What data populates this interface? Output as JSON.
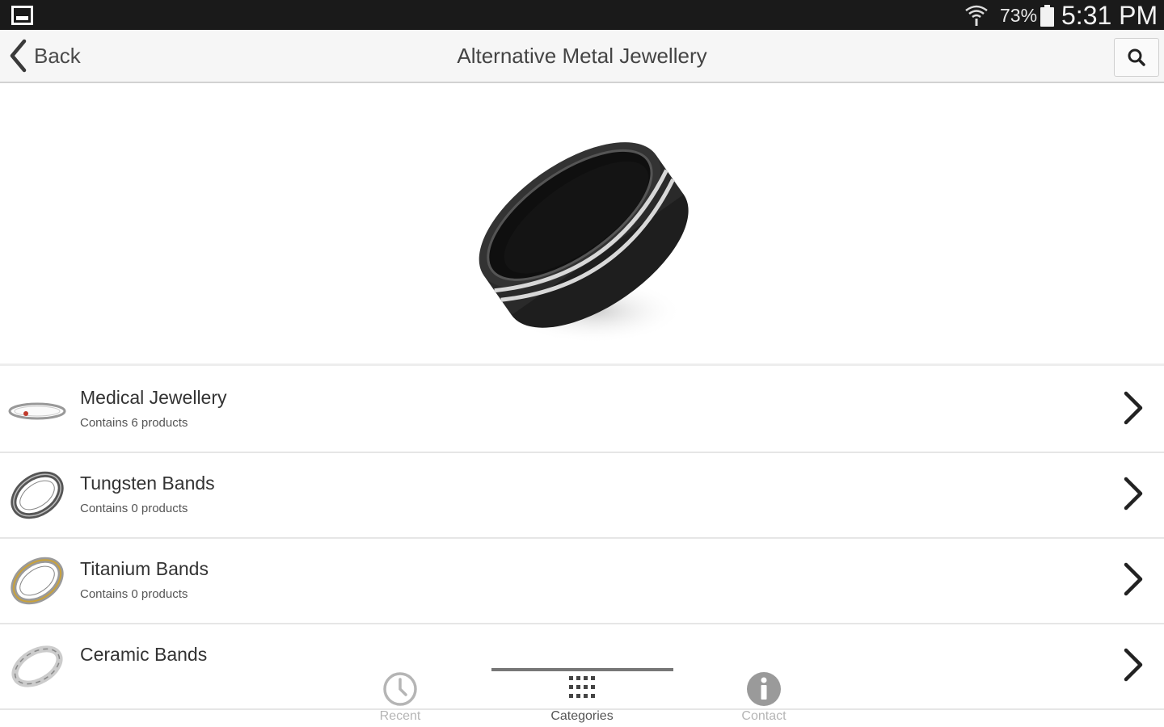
{
  "status_bar": {
    "battery_percent": "73%",
    "time": "5:31 PM",
    "icons": [
      "gallery-icon",
      "wifi-icon",
      "battery-icon"
    ]
  },
  "header": {
    "back_label": "Back",
    "title": "Alternative Metal Jewellery",
    "search_icon": "search-icon"
  },
  "hero": {
    "image": "black-tungsten-ring-with-silver-stripes"
  },
  "categories": [
    {
      "name": "Medical Jewellery",
      "subtitle": "Contains 6 products",
      "thumb": "medical-bracelet"
    },
    {
      "name": "Tungsten Bands",
      "subtitle": "Contains 0 products",
      "thumb": "tungsten-ring"
    },
    {
      "name": "Titanium Bands",
      "subtitle": "Contains 0 products",
      "thumb": "titanium-ring"
    },
    {
      "name": "Ceramic Bands",
      "subtitle": "",
      "thumb": "ceramic-ring"
    }
  ],
  "tabbar": {
    "tabs": [
      {
        "label": "Recent",
        "icon": "clock-icon",
        "active": false
      },
      {
        "label": "Categories",
        "icon": "grid-icon",
        "active": true
      },
      {
        "label": "Contact",
        "icon": "info-icon",
        "active": false
      }
    ]
  },
  "colors": {
    "status_bar_bg": "#1a1a1a",
    "header_bg": "#f6f6f6",
    "active_tab": "#555555",
    "inactive_tab": "#b5b5b5"
  }
}
